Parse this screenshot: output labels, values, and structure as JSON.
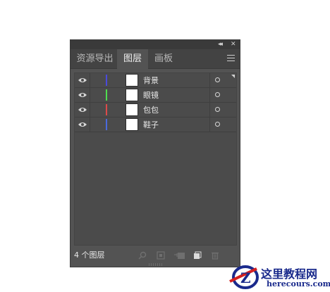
{
  "panel": {
    "titlebar": {
      "collapse_glyph": "◂◂",
      "close_glyph": "✕"
    },
    "tabs": [
      {
        "label": "资源导出",
        "active": false
      },
      {
        "label": "图层",
        "active": true
      },
      {
        "label": "画板",
        "active": false
      }
    ],
    "menu_icon": "hamburger-menu-icon",
    "layers": [
      {
        "name": "背景",
        "color": "#4a4adc"
      },
      {
        "name": "眼镜",
        "color": "#4fdc4f"
      },
      {
        "name": "包包",
        "color": "#dc4a4a"
      },
      {
        "name": "鞋子",
        "color": "#4a6adc"
      }
    ],
    "footer": {
      "count_text": "4 个图层",
      "icons": [
        "search-icon",
        "export-icon",
        "clipping-mask-icon",
        "new-layer-icon",
        "trash-icon"
      ]
    }
  },
  "watermark": {
    "site_name": "这里教程网",
    "site_url": "herecours.com"
  }
}
